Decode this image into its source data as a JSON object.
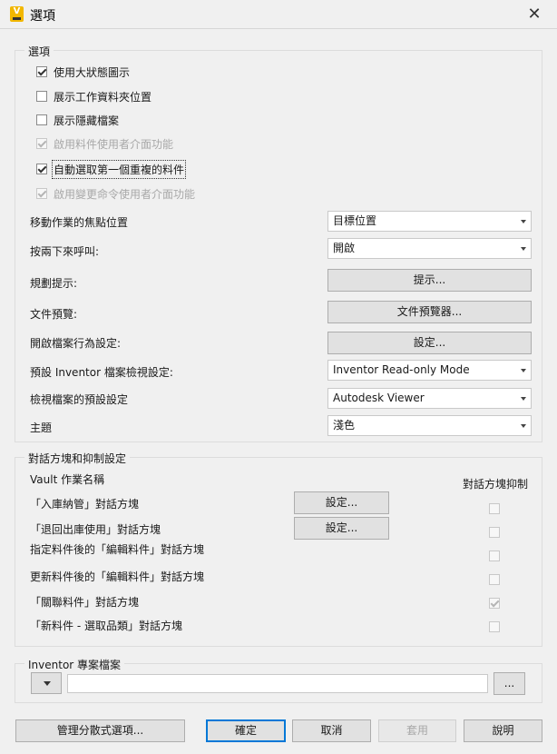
{
  "window": {
    "title": "選項",
    "close_label": "✕",
    "app_icon_letter": "V"
  },
  "options": {
    "group_label": "選項",
    "checkboxes": [
      {
        "label": "使用大狀態圖示",
        "checked": true,
        "disabled": false
      },
      {
        "label": "展示工作資料夾位置",
        "checked": false,
        "disabled": false
      },
      {
        "label": "展示隱藏檔案",
        "checked": false,
        "disabled": false
      },
      {
        "label": "啟用料件使用者介面功能",
        "checked": true,
        "disabled": true
      },
      {
        "label": "自動選取第一個重複的料件",
        "checked": true,
        "disabled": false
      },
      {
        "label": "啟用變更命令使用者介面功能",
        "checked": true,
        "disabled": true
      }
    ],
    "rows": {
      "focus_position": {
        "label": "移動作業的焦點位置",
        "value": "目標位置"
      },
      "double_click": {
        "label": "按兩下來呼叫:",
        "value": "開啟"
      },
      "planning_hints": {
        "label": "規劃提示:",
        "button": "提示..."
      },
      "doc_preview": {
        "label": "文件預覽:",
        "button": "文件預覽器..."
      },
      "open_behavior": {
        "label": "開啟檔案行為設定:",
        "button": "設定..."
      },
      "inventor_view": {
        "label": "預設 Inventor 檔案檢視設定:",
        "value": "Inventor Read-only Mode"
      },
      "viewer_default": {
        "label": "檢視檔案的預設設定",
        "value": "Autodesk Viewer"
      },
      "theme": {
        "label": "主題",
        "value": "淺色"
      }
    }
  },
  "dialogs": {
    "group_label": "對話方塊和抑制設定",
    "col_operation": "Vault 作業名稱",
    "col_suppress": "對話方塊抑制",
    "items": [
      {
        "label": "「入庫納管」對話方塊",
        "button": "設定...",
        "suppressed": false
      },
      {
        "label": "「退回出庫使用」對話方塊",
        "button": "設定...",
        "suppressed": false
      },
      {
        "label": "指定料件後的「編輯料件」對話方塊",
        "button": "",
        "suppressed": false
      },
      {
        "label": "更新料件後的「編輯料件」對話方塊",
        "button": "",
        "suppressed": false
      },
      {
        "label": "「關聯料件」對話方塊",
        "button": "",
        "suppressed": true
      },
      {
        "label": "「新料件 - 選取品類」對話方塊",
        "button": "",
        "suppressed": false
      }
    ]
  },
  "project": {
    "group_label": "Inventor 專案檔案",
    "path_value": "",
    "browse_label": "..."
  },
  "footer": {
    "manage_label": "管理分散式選項...",
    "ok_label": "確定",
    "cancel_label": "取消",
    "apply_label": "套用",
    "help_label": "說明"
  }
}
